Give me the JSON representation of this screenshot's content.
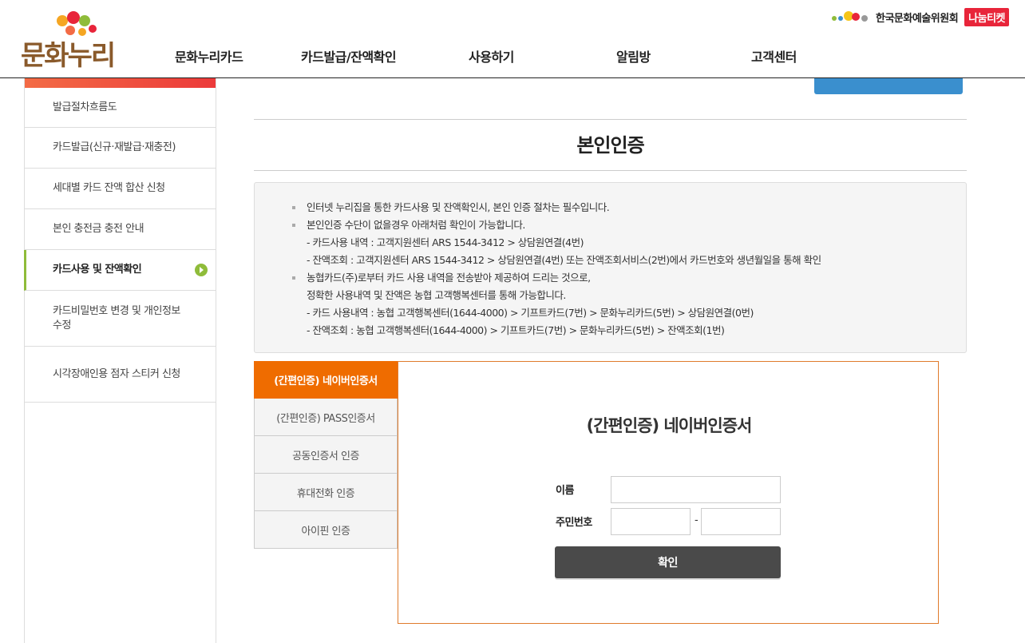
{
  "header": {
    "logo_text": "문화누리",
    "nav": [
      {
        "label": "문화누리카드"
      },
      {
        "label": "카드발급/잔액확인"
      },
      {
        "label": "사용하기"
      },
      {
        "label": "알림방"
      },
      {
        "label": "고객센터"
      }
    ],
    "partner_name": "한국문화예술위원회",
    "partner_badge": "나눔티켓"
  },
  "sidebar": {
    "items": [
      {
        "label": "발급절차흐름도"
      },
      {
        "label": "카드발급(신규·재발급·재충전)"
      },
      {
        "label": "세대별 카드 잔액 합산 신청"
      },
      {
        "label": "본인 충전금 충전 안내"
      },
      {
        "label": "카드사용 및 잔액확인",
        "active": true
      },
      {
        "label": "카드비밀번호 변경 및 개인정보수정"
      },
      {
        "label": "시각장애인용 점자 스티커 신청"
      }
    ]
  },
  "main": {
    "page_title": "본인인증",
    "notice": [
      "인터넷 누리집을 통한 카드사용 및 잔액확인시, 본인 인증 절차는 필수입니다.",
      "본인인증 수단이 없을경우 아래처럼 확인이 가능합니다.",
      "- 카드사용 내역 : 고객지원센터 ARS 1544-3412 > 상담원연결(4번)",
      "- 잔액조회 : 고객지원센터 ARS 1544-3412 > 상담원연결(4번) 또는 잔액조회서비스(2번)에서 카드번호와 생년월일을 통해 확인",
      "농협카드(주)로부터 카드 사용 내역을 전송받아 제공하여 드리는 것으로,",
      "정확한 사용내역 및 잔액은 농협 고객행복센터를 통해 가능합니다.",
      "- 카드 사용내역 : 농협 고객행복센터(1644-4000) > 기프트카드(7번) > 문화누리카드(5번) > 상담원연결(0번)",
      "- 잔액조회 : 농협 고객행복센터(1644-4000) > 기프트카드(7번) > 문화누리카드(5번) > 잔액조회(1번)"
    ],
    "tabs": [
      {
        "label": "(간편인증) 네이버인증서",
        "active": true
      },
      {
        "label": "(간편인증) PASS인증서"
      },
      {
        "label": "공동인증서 인증"
      },
      {
        "label": "휴대전화 인증"
      },
      {
        "label": "아이핀 인증"
      }
    ],
    "auth": {
      "title": "(간편인증) 네이버인증서",
      "name_label": "이름",
      "name_value": "",
      "rrn_label": "주민번호",
      "rrn_first": "",
      "rrn_dash": "-",
      "rrn_second": "",
      "confirm_label": "확인"
    }
  },
  "colors": {
    "accent_orange": "#ef6c00",
    "lnb_green": "#8fbc3a",
    "lnb_top_red": "#ec3a3a",
    "button_dark": "#4a4a4a"
  }
}
